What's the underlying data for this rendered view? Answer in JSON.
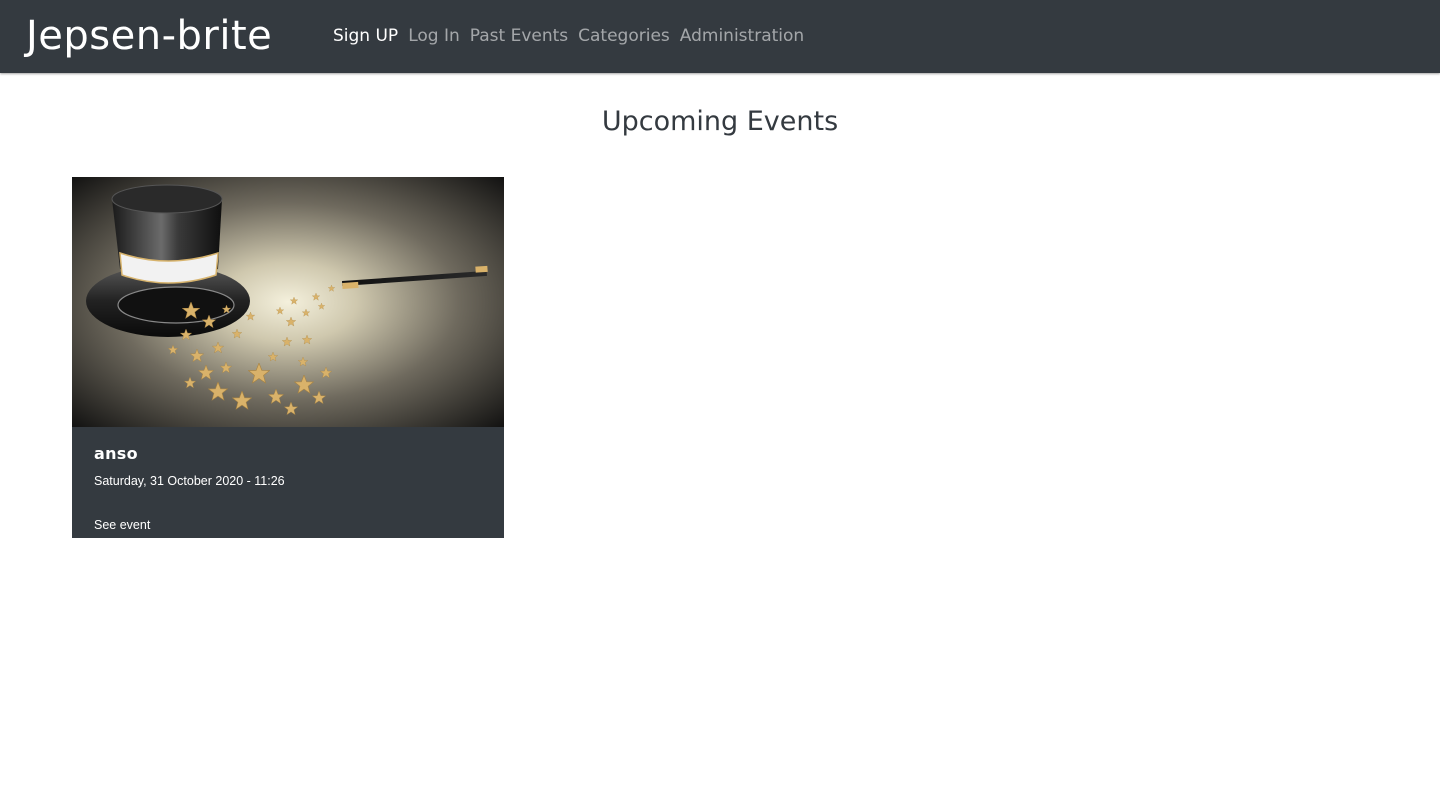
{
  "navbar": {
    "brand": "Jepsen-brite",
    "links": [
      {
        "label": "Sign UP",
        "active": true
      },
      {
        "label": "Log In",
        "active": false
      },
      {
        "label": "Past Events",
        "active": false
      },
      {
        "label": "Categories",
        "active": false
      },
      {
        "label": "Administration",
        "active": false
      }
    ]
  },
  "main": {
    "title": "Upcoming Events",
    "events": [
      {
        "image": "magic-hat-wand-stars",
        "name": "anso",
        "date": "Saturday, 31 October 2020 - 11:26",
        "link_label": "See event"
      }
    ]
  },
  "colors": {
    "navbar_bg": "#343a40",
    "card_bg": "#343a40",
    "gold": "#d9b26a"
  }
}
